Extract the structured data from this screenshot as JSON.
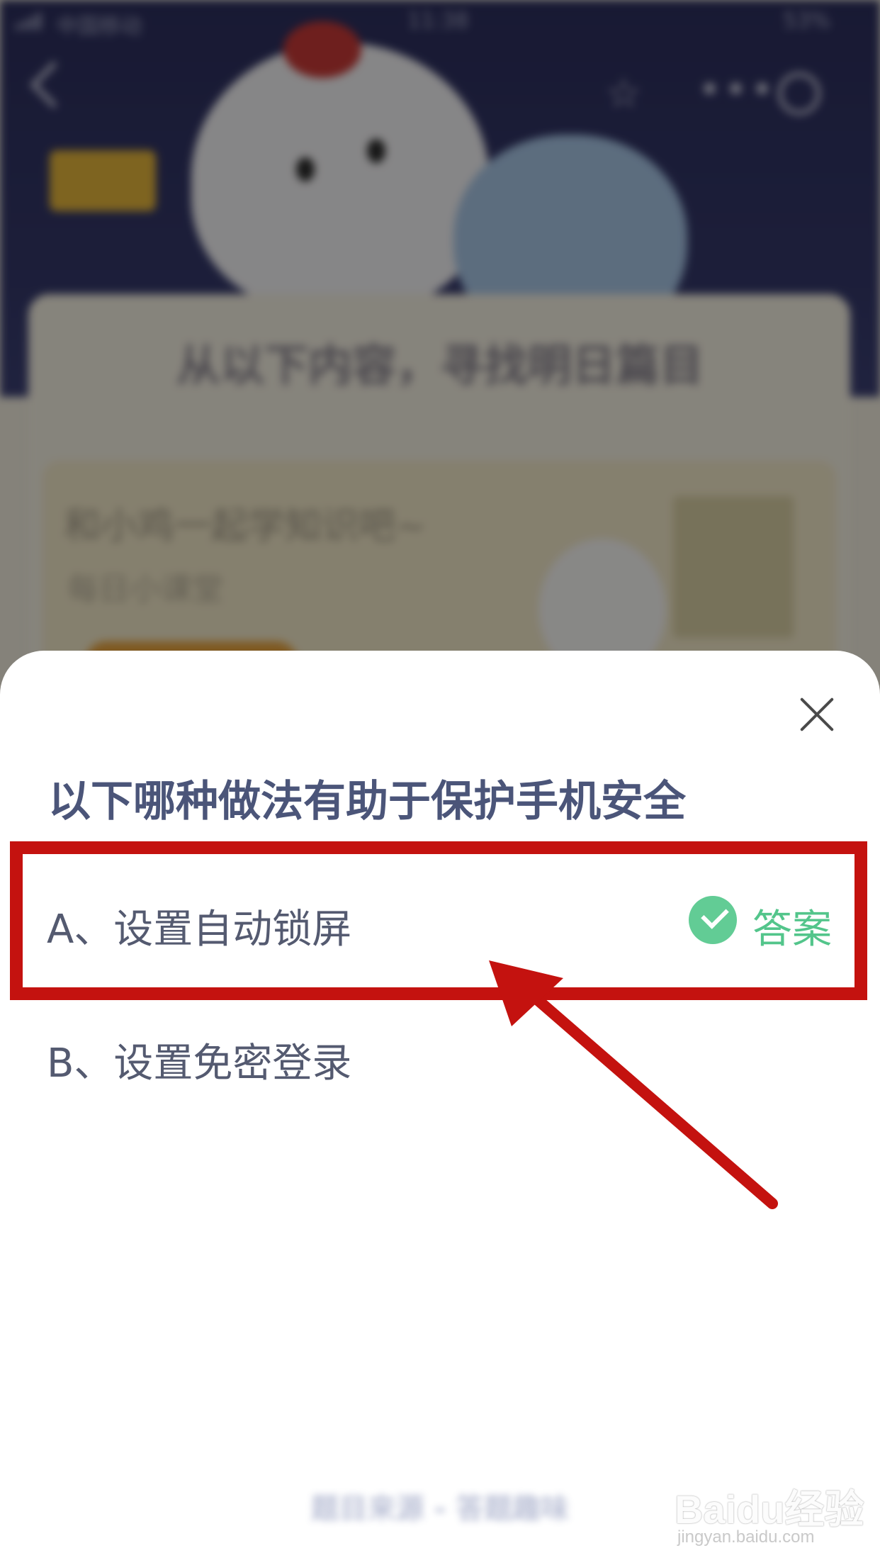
{
  "background": {
    "status_bar": {
      "carrier": "中国移动",
      "time": "11:38",
      "battery": "53%"
    },
    "card_title": "从以下内容，寻找明日篇目",
    "inner_card": {
      "heading": "和小鸡一起学知识吧~",
      "subheading": "每日小课堂"
    }
  },
  "quiz": {
    "question": "以下哪种做法有助于保护手机安全",
    "options": [
      {
        "label": "A、设置自动锁屏",
        "is_answer": true,
        "answer_tag": "答案"
      },
      {
        "label": "B、设置免密登录",
        "is_answer": false
      }
    ],
    "footer": "题目来源 - 答题趣味"
  },
  "annotation": {
    "highlight_color": "#c4120f"
  },
  "watermark": {
    "brand": "Baidu经验",
    "url": "jingyan.baidu.com"
  },
  "colors": {
    "answer_green": "#62cc95",
    "question_text": "#4b5579"
  }
}
